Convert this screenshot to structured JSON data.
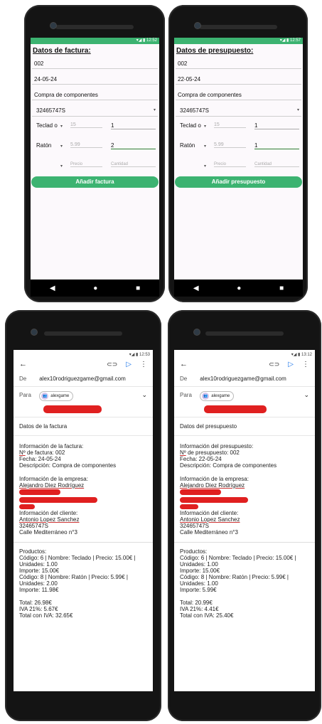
{
  "form1": {
    "status_time": "12:52",
    "title": "Datos de factura:",
    "number": "002",
    "date": "24-05-24",
    "description": "Compra de componentes",
    "client_id": "32465747S",
    "items": [
      {
        "name": "Teclad o",
        "price": "15",
        "qty": "1"
      },
      {
        "name": "Ratón",
        "price": "5.99",
        "qty": "2"
      }
    ],
    "price_placeholder": "Precio",
    "qty_placeholder": "Cantidad",
    "button": "Añadir factura"
  },
  "form2": {
    "status_time": "12:57",
    "title": "Datos de presupuesto:",
    "number": "002",
    "date": "22-05-24",
    "description": "Compra de componentes",
    "client_id": "32465747S",
    "items": [
      {
        "name": "Teclad o",
        "price": "15",
        "qty": "1"
      },
      {
        "name": "Ratón",
        "price": "5.99",
        "qty": "1"
      }
    ],
    "price_placeholder": "Precio",
    "qty_placeholder": "Cantidad",
    "button": "Añadir presupuesto"
  },
  "nav": {
    "back": "◀",
    "home": "●",
    "recents": "■"
  },
  "email1": {
    "status_time": "12:53",
    "from_label": "De",
    "from": "alex10rodriguezgame@gmail.com",
    "to_label": "Para",
    "chip": "alexgame",
    "subject": "Datos de la factura",
    "doc_header": "Información de la factura:",
    "doc_number_label": "Nº",
    "doc_number": "de factura: 002",
    "date": "Fecha: 24-05-24",
    "description": "Descripción: Compra de componentes",
    "company_header": "Información de la empresa:",
    "company_name": "Alejandro Diez Rodríguez",
    "client_header": "Información del cliente:",
    "client_name": "Antonio Lopez Sanchez",
    "client_id": "32465747S",
    "client_address": "Calle Mediterráneo n°3",
    "products_header": "Productos:",
    "product_lines": [
      "Código: 6 | Nombre: Teclado | Precio: 15.00€ |",
      "Unidades: 1.00",
      "Importe: 15.00€",
      "Código: 8 | Nombre: Ratón | Precio: 5.99€ |",
      "Unidades: 2.00",
      "Importe: 11.98€"
    ],
    "total": "Total: 26.98€",
    "iva": "IVA 21%: 5.67€",
    "total_iva": "Total con IVA: 32.65€"
  },
  "email2": {
    "status_time": "13:12",
    "from_label": "De",
    "from": "alex10rodriguezgame@gmail.com",
    "to_label": "Para",
    "chip": "alexgame",
    "subject": "Datos del presupuesto",
    "doc_header": "Información del presupuesto:",
    "doc_number_label": "Nº",
    "doc_number": "de presupuesto: 002",
    "date": "Fecha: 22-05-24",
    "description": "Descripción: Compra de componentes",
    "company_header": "Información de la empresa:",
    "company_name": "Alejandro Diez Rodríguez",
    "client_header": "Información del cliente:",
    "client_name": "Antonio Lopez Sanchez",
    "client_id": "32465747S",
    "client_address": "Calle Mediterráneo n°3",
    "products_header": "Productos:",
    "product_lines": [
      "Código: 6 | Nombre: Teclado | Precio: 15.00€ |",
      "Unidades: 1.00",
      "Importe: 15.00€",
      "Código: 8 | Nombre: Ratón | Precio: 5.99€ |",
      "Unidades: 1.00",
      "Importe: 5.99€"
    ],
    "total": "Total: 20.99€",
    "iva": "IVA 21%: 4.41€",
    "total_iva": "Total con IVA: 25.40€"
  },
  "colors": {
    "accent": "#3cb371",
    "redaction": "#e02020",
    "send": "#1a73e8"
  }
}
